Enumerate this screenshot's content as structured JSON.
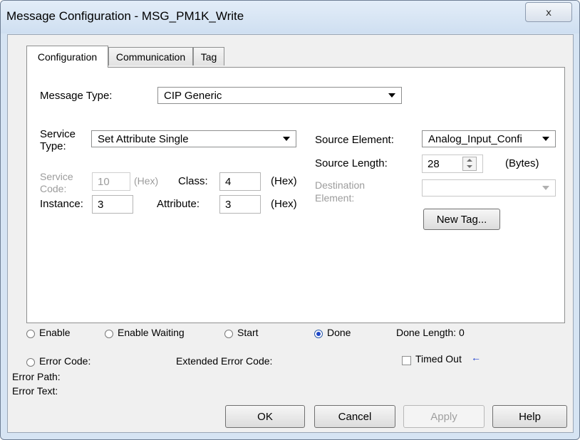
{
  "window": {
    "title": "Message Configuration - MSG_PM1K_Write",
    "close_glyph": "ⅹ"
  },
  "tabs": [
    {
      "label": "Configuration",
      "active": true
    },
    {
      "label": "Communication",
      "active": false
    },
    {
      "label": "Tag",
      "active": false
    }
  ],
  "config": {
    "message_type_label": "Message Type:",
    "message_type_value": "CIP Generic",
    "service_type_label": "Service Type:",
    "service_type_value": "Set Attribute Single",
    "service_code_label": "Service Code:",
    "service_code_value": "10",
    "service_code_unit": "(Hex)",
    "class_label": "Class:",
    "class_value": "4",
    "class_unit": "(Hex)",
    "instance_label": "Instance:",
    "instance_value": "3",
    "attribute_label": "Attribute:",
    "attribute_value": "3",
    "attribute_unit": "(Hex)",
    "source_element_label": "Source Element:",
    "source_element_value": "Analog_Input_Confi",
    "source_length_label": "Source Length:",
    "source_length_value": "28",
    "source_length_unit": "(Bytes)",
    "destination_element_label": "Destination Element:",
    "destination_element_value": "",
    "new_tag_label": "New Tag..."
  },
  "status": {
    "enable": "Enable",
    "enable_waiting": "Enable Waiting",
    "start": "Start",
    "done": "Done",
    "done_length": "Done Length: 0",
    "error_code": "Error Code:",
    "extended_error_code": "Extended Error Code:",
    "timed_out": "Timed Out",
    "timed_out_arrow": "←",
    "error_path": "Error Path:",
    "error_text": "Error Text:"
  },
  "buttons": {
    "ok": "OK",
    "cancel": "Cancel",
    "apply": "Apply",
    "help": "Help"
  },
  "colors": {
    "accent_arrow": "#1e3fd0",
    "radio_selected": "#1d47c8"
  }
}
